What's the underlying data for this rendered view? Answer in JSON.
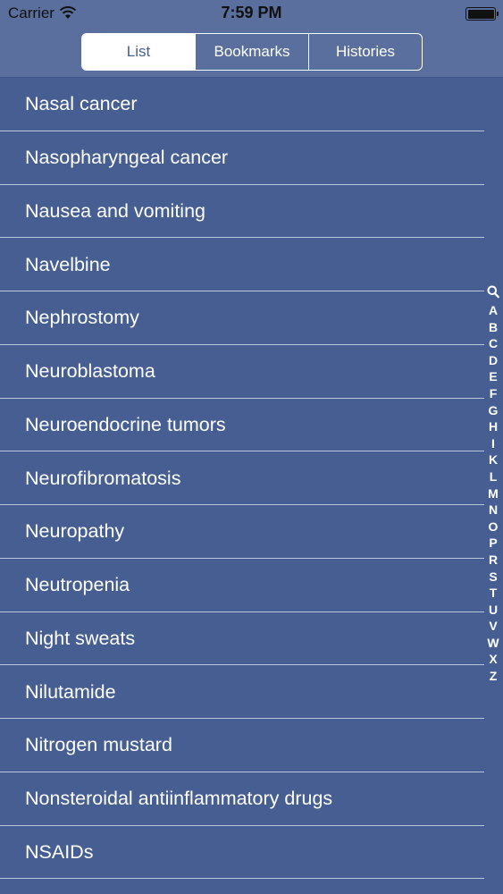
{
  "status_bar": {
    "carrier": "Carrier",
    "time": "7:59 PM"
  },
  "nav": {
    "segments": [
      {
        "label": "List",
        "selected": true
      },
      {
        "label": "Bookmarks",
        "selected": false
      },
      {
        "label": "Histories",
        "selected": false
      }
    ]
  },
  "list": {
    "items": [
      "Nasal cancer",
      "Nasopharyngeal cancer",
      "Nausea and vomiting",
      "Navelbine",
      "Nephrostomy",
      "Neuroblastoma",
      "Neuroendocrine tumors",
      "Neurofibromatosis",
      "Neuropathy",
      "Neutropenia",
      "Night sweats",
      "Nilutamide",
      "Nitrogen mustard",
      "Nonsteroidal antiinflammatory drugs",
      "NSAIDs"
    ]
  },
  "index_bar": {
    "search_icon": "magnifier-icon",
    "letters": [
      "A",
      "B",
      "C",
      "D",
      "E",
      "F",
      "G",
      "H",
      "I",
      "K",
      "L",
      "M",
      "N",
      "O",
      "P",
      "R",
      "S",
      "T",
      "U",
      "V",
      "W",
      "X",
      "Z"
    ]
  },
  "colors": {
    "background": "#475e92",
    "nav_background": "#5a6f9d",
    "text": "#ffffff"
  }
}
